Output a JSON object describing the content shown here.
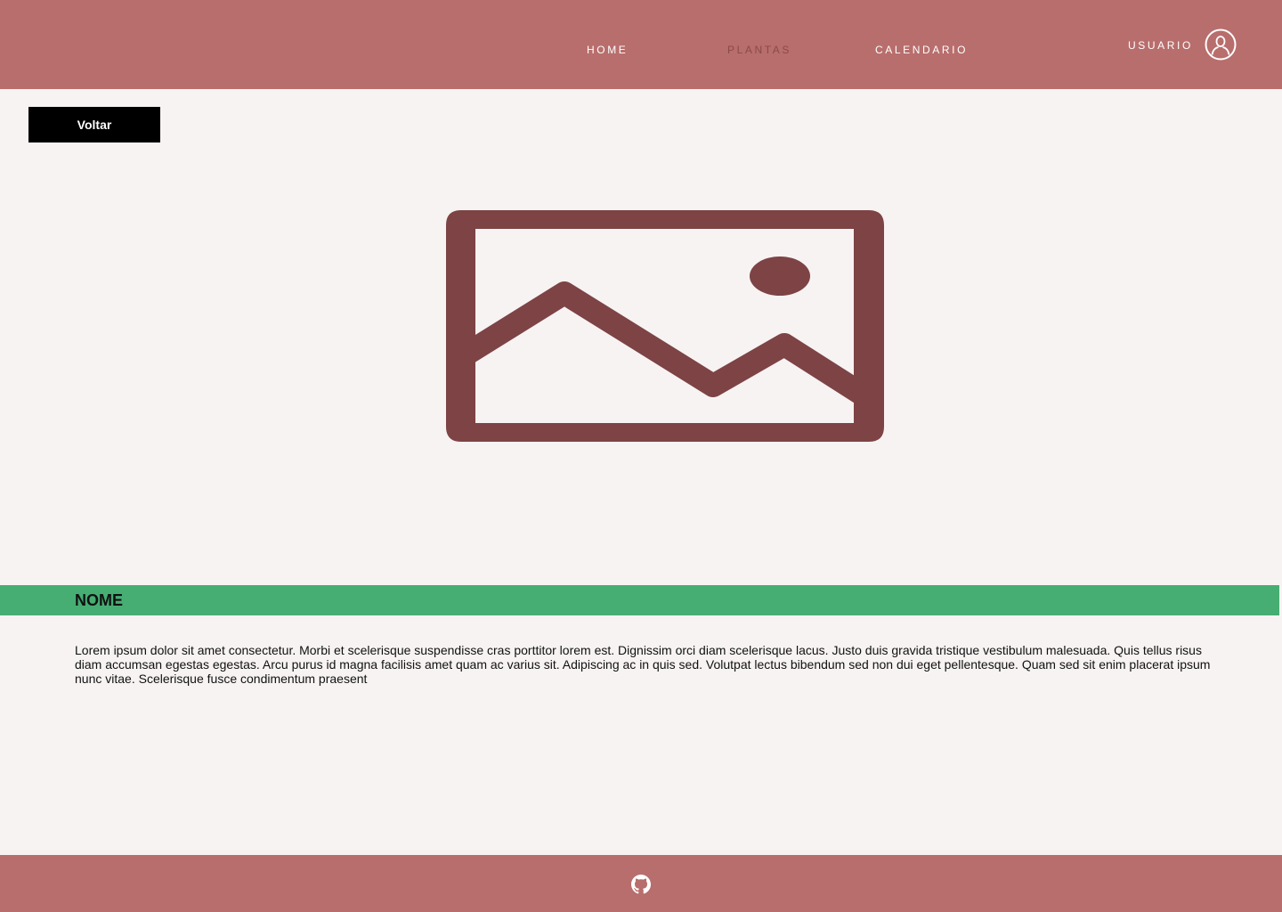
{
  "nav": {
    "items": [
      {
        "label": "HOME",
        "active": false
      },
      {
        "label": "PLANTAS",
        "active": true
      },
      {
        "label": "CALENDARIO",
        "active": false
      }
    ],
    "user_label": "USUARIO",
    "user_icon": "user-circle-icon"
  },
  "back_button": {
    "label": "Voltar"
  },
  "plant": {
    "image_icon": "image-placeholder-icon",
    "name": "NOME",
    "description": "Lorem ipsum dolor sit amet consectetur. Morbi et scelerisque suspendisse cras porttitor lorem est. Dignissim orci diam scelerisque lacus. Justo duis gravida tristique vestibulum malesuada. Quis tellus risus diam accumsan egestas egestas. Arcu purus id magna facilisis amet quam ac varius sit. Adipiscing ac in quis sed. Volutpat lectus bibendum sed non dui eget pellentesque. Quam sed sit enim placerat ipsum nunc vitae. Scelerisque fusce condimentum praesent"
  },
  "footer": {
    "icon": "github-icon"
  },
  "colors": {
    "header_bg": "#b86e6c",
    "page_bg": "#f7f3f2",
    "name_bar_bg": "#46ae73",
    "placeholder": "#7d4345",
    "active_nav": "#8a4a4a",
    "button_bg": "#000000"
  }
}
